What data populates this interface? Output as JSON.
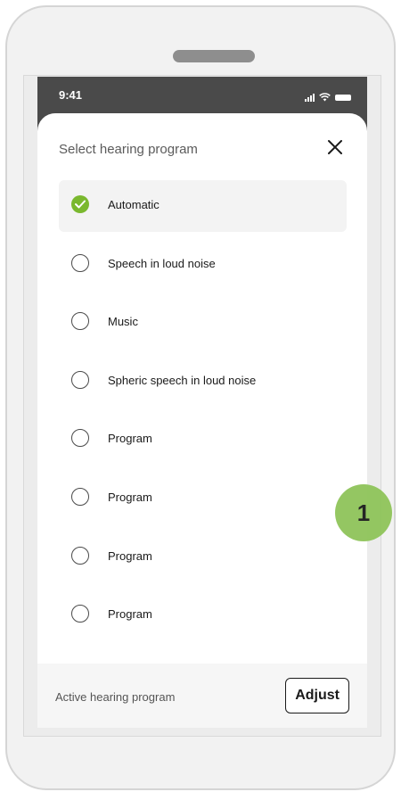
{
  "status_bar": {
    "time": "9:41"
  },
  "sheet": {
    "title": "Select hearing program",
    "programs": [
      {
        "label": "Automatic",
        "selected": true
      },
      {
        "label": "Speech in loud noise",
        "selected": false
      },
      {
        "label": "Music",
        "selected": false
      },
      {
        "label": "Spheric speech in loud noise",
        "selected": false
      },
      {
        "label": "Program",
        "selected": false
      },
      {
        "label": "Program",
        "selected": false
      },
      {
        "label": "Program",
        "selected": false
      },
      {
        "label": "Program",
        "selected": false
      }
    ]
  },
  "footer": {
    "label": "Active hearing program",
    "adjust_label": "Adjust"
  },
  "callout": {
    "number": "1"
  },
  "colors": {
    "accent_green": "#7ab82e",
    "callout_green": "#8fc45a",
    "status_bar_bg": "#4a4a4a"
  },
  "icons": [
    "signal-icon",
    "wifi-icon",
    "battery-icon",
    "close-icon",
    "checkmark-icon"
  ]
}
